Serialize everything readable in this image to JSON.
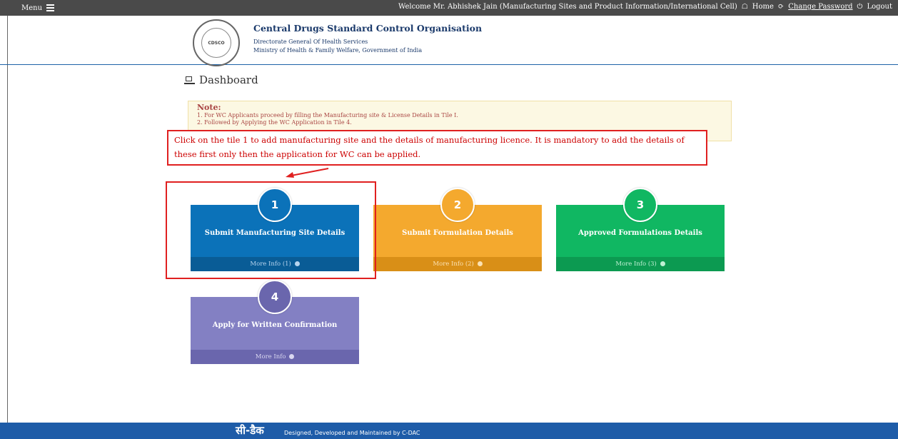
{
  "topbar": {
    "menu_label": "Menu",
    "welcome_text": "Welcome Mr. Abhishek Jain  (Manufacturing Sites and Product Information/International Cell)",
    "home_label": "Home",
    "change_password_label": "Change Password",
    "logout_label": "Logout"
  },
  "header": {
    "seal_text": "CDSCO",
    "org_title": "Central Drugs Standard Control Organisation",
    "org_sub1": "Directorate General Of Health Services",
    "org_sub2": "Ministry of Health & Family Welfare, Government of India"
  },
  "dashboard": {
    "title": "Dashboard"
  },
  "note": {
    "heading": "Note:",
    "lines": [
      "1. For WC Applicants proceed by filling the Manufacturing site & License Details in Tile I.",
      "2. Followed by Applying the WC Application in Tile 4."
    ]
  },
  "callout": {
    "text": "Click on the tile 1 to add manufacturing site and the details of manufacturing licence. It is mandatory to add the details of these first only then the application for WC can be applied."
  },
  "tiles": [
    {
      "number": "1",
      "label": "Submit Manufacturing Site Details",
      "more": "More Info (1)",
      "color": "#0b72b9"
    },
    {
      "number": "2",
      "label": "Submit Formulation Details",
      "more": "More Info (2)",
      "color": "#f4a92e"
    },
    {
      "number": "3",
      "label": "Approved Formulations Details",
      "more": "More Info (3)",
      "color": "#10b762"
    },
    {
      "number": "4",
      "label": "Apply for Written Confirmation",
      "more": "More Info",
      "color": "#8380c3"
    }
  ],
  "footer": {
    "logo_text": "सी-डैक",
    "text": "Designed, Developed and Maintained by C-DAC"
  },
  "icons": [
    "hamburger-icon",
    "home-icon",
    "refresh-icon",
    "power-icon",
    "laptop-icon",
    "arrow-circle-right-icon"
  ]
}
